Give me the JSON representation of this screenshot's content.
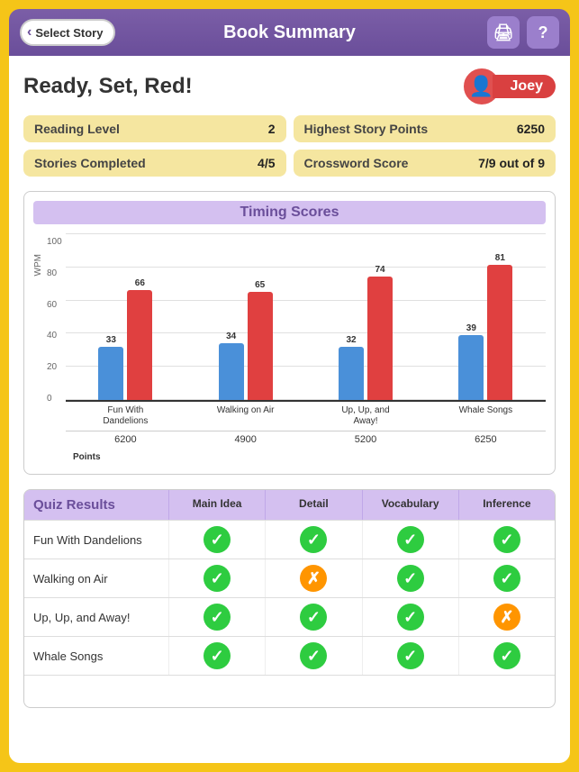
{
  "header": {
    "back_label": "Select Story",
    "title": "Book Summary",
    "print_icon": "🖨",
    "help_icon": "?"
  },
  "book": {
    "title": "Ready, Set, Red!"
  },
  "user": {
    "name": "Joey",
    "avatar_icon": "👤"
  },
  "stats": [
    {
      "label": "Reading Level",
      "value": "2"
    },
    {
      "label": "Highest Story Points",
      "value": "6250"
    },
    {
      "label": "Stories Completed",
      "value": "4/5"
    },
    {
      "label": "Crossword Score",
      "value": "7/9 out of 9"
    }
  ],
  "chart": {
    "title": "Timing Scores",
    "y_axis_label": "WPM",
    "y_ticks": [
      "100",
      "80",
      "60",
      "40",
      "20",
      "0"
    ],
    "bars": [
      {
        "x_label": "Fun With\nDandelions",
        "blue": 33,
        "red": 66,
        "points": "6200"
      },
      {
        "x_label": "Walking on Air",
        "blue": 34,
        "red": 65,
        "points": "4900"
      },
      {
        "x_label": "Up, Up, and\nAway!",
        "blue": 32,
        "red": 74,
        "points": "5200"
      },
      {
        "x_label": "Whale Songs",
        "blue": 39,
        "red": 81,
        "points": "6250"
      }
    ],
    "points_label": "Points"
  },
  "quiz": {
    "title": "Quiz Results",
    "columns": [
      "Main Idea",
      "Detail",
      "Vocabulary",
      "Inference"
    ],
    "rows": [
      {
        "label": "Fun With Dandelions",
        "results": [
          "green",
          "green",
          "green",
          "green"
        ]
      },
      {
        "label": "Walking on Air",
        "results": [
          "green",
          "orange",
          "green",
          "green"
        ]
      },
      {
        "label": "Up, Up, and Away!",
        "results": [
          "green",
          "green",
          "green",
          "orange"
        ]
      },
      {
        "label": "Whale Songs",
        "results": [
          "green",
          "green",
          "green",
          "green"
        ]
      }
    ]
  }
}
